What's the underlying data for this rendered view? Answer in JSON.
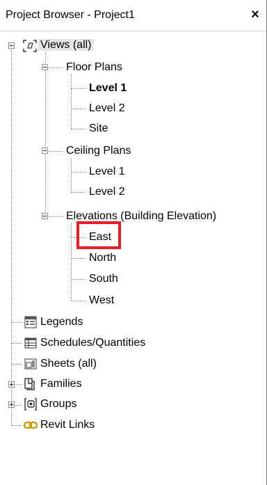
{
  "panel": {
    "title": "Project Browser - Project1",
    "close_glyph": "×"
  },
  "tree": {
    "views_all": "Views (all)",
    "floor_plans": {
      "label": "Floor Plans",
      "items": [
        "Level 1",
        "Level 2",
        "Site"
      ],
      "active_item": "Level 1"
    },
    "ceiling_plans": {
      "label": "Ceiling Plans",
      "items": [
        "Level 1",
        "Level 2"
      ]
    },
    "elevations": {
      "label": "Elevations (Building Elevation)",
      "items": [
        "East",
        "North",
        "South",
        "West"
      ]
    },
    "legends": "Legends",
    "schedules": "Schedules/Quantities",
    "sheets": "Sheets (all)",
    "families": "Families",
    "groups": "Groups",
    "revit_links": "Revit Links"
  },
  "highlight": {
    "target": "East",
    "color": "#ee1c24"
  },
  "icons": {
    "views": "views-bracket-icon",
    "legends": "legend-icon",
    "schedules": "schedule-table-icon",
    "sheets": "sheet-icon",
    "families": "families-icon",
    "groups": "groups-icon",
    "revit_links": "chain-link-icon"
  }
}
